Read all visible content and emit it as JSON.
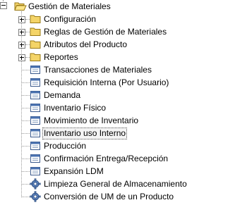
{
  "tree": {
    "root": {
      "label": "Gestión de Materiales",
      "icon": "folder-open-icon",
      "expanded": true
    },
    "folders": [
      {
        "label": "Configuración",
        "icon": "folder-icon"
      },
      {
        "label": "Reglas de Gestión de Materiales",
        "icon": "folder-icon"
      },
      {
        "label": "Atributos del Producto",
        "icon": "folder-icon"
      },
      {
        "label": "Reportes",
        "icon": "folder-icon"
      }
    ],
    "items": [
      {
        "label": "Transacciones de Materiales",
        "icon": "window-icon"
      },
      {
        "label": "Requisición Interna (Por Usuario)",
        "icon": "window-icon"
      },
      {
        "label": "Demanda",
        "icon": "window-icon"
      },
      {
        "label": "Inventario Físico",
        "icon": "window-icon"
      },
      {
        "label": "Movimiento de Inventario",
        "icon": "window-icon"
      },
      {
        "label": "Inventario uso Interno",
        "icon": "window-icon",
        "selected": true
      },
      {
        "label": "Producción",
        "icon": "window-icon"
      },
      {
        "label": "Confirmación Entrega/Recepción",
        "icon": "window-icon"
      },
      {
        "label": "Expansión LDM",
        "icon": "window-icon"
      },
      {
        "label": "Limpieza General de Almacenamiento",
        "icon": "process-gear-icon"
      },
      {
        "label": "Conversión de UM de un Producto",
        "icon": "process-gear-icon"
      }
    ]
  }
}
